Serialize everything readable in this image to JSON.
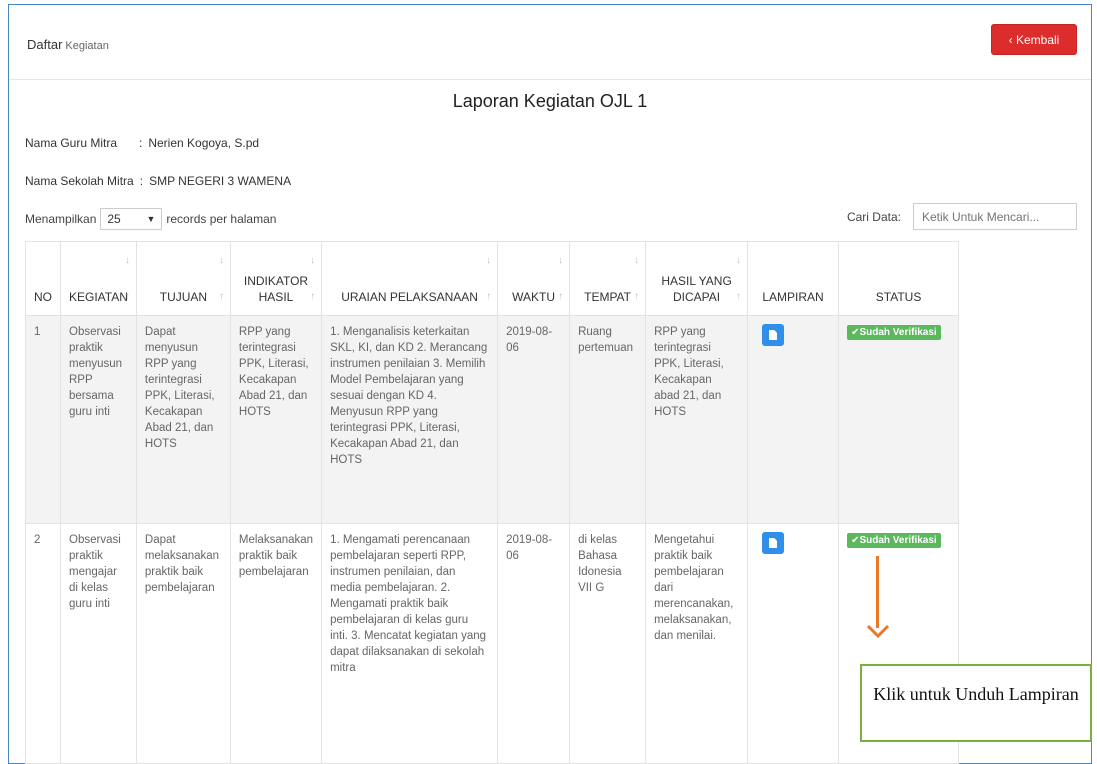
{
  "header": {
    "title": "Daftar",
    "subtitle": "Kegiatan",
    "back_button": "‹ Kembali"
  },
  "report": {
    "title": "Laporan Kegiatan OJL 1",
    "guru_label": "Nama Guru Mitra",
    "guru_sep": ":",
    "guru_value": "Nerien Kogoya, S.pd",
    "sekolah_label": "Nama Sekolah Mitra",
    "sekolah_sep": ":",
    "sekolah_value": "SMP NEGERI 3 WAMENA"
  },
  "controls": {
    "show_label": "Menampilkan",
    "page_size": "25",
    "records_label": "records per halaman",
    "search_label": "Cari Data:",
    "search_placeholder": "Ketik Untuk Mencari..."
  },
  "table": {
    "headers": {
      "no": "NO",
      "kegiatan": "KEGIATAN",
      "tujuan": "TUJUAN",
      "indikator": "INDIKATOR HASIL",
      "uraian": "URAIAN PELAKSANAAN",
      "waktu": "WAKTU",
      "tempat": "TEMPAT",
      "hasil": "HASIL YANG DICAPAI",
      "lampiran": "LAMPIRAN",
      "status": "STATUS"
    },
    "rows": [
      {
        "no": "1",
        "kegiatan": "Observasi praktik menyusun RPP bersama guru inti",
        "tujuan": "Dapat menyusun RPP yang terintegrasi PPK, Literasi, Kecakapan Abad 21, dan HOTS",
        "indikator": "RPP yang terintegrasi PPK, Literasi, Kecakapan Abad 21, dan HOTS",
        "uraian": "1. Menganalisis keterkaitan SKL, KI, dan KD 2. Merancang instrumen penilaian 3. Memilih Model Pembelajaran yang sesuai dengan KD 4. Menyusun RPP yang terintegrasi PPK, Literasi, Kecakapan Abad 21, dan HOTS",
        "waktu": "2019-08-06",
        "tempat": "Ruang pertemuan",
        "hasil": "RPP yang terintegrasi PPK, Literasi, Kecakapan abad 21, dan HOTS",
        "lampiran_icon": "document-icon",
        "status": "✔Sudah Verifikasi"
      },
      {
        "no": "2",
        "kegiatan": "Observasi praktik mengajar di kelas guru inti",
        "tujuan": "Dapat melaksanakan praktik baik pembelajaran",
        "indikator": "Melaksanakan praktik baik pembelajaran",
        "uraian": "1. Mengamati perencanaan pembelajaran seperti RPP, instrumen penilaian, dan media pembelajaran. 2. Mengamati praktik baik pembelajaran di kelas guru inti. 3. Mencatat kegiatan yang dapat dilaksanakan di sekolah mitra",
        "waktu": "2019-08-06",
        "tempat": "di kelas Bahasa Idonesia VII G",
        "hasil": "Mengetahui praktik baik pembelajaran dari merencanakan, melaksanakan, dan menilai.",
        "lampiran_icon": "document-icon",
        "status": "✔Sudah Verifikasi"
      }
    ]
  },
  "callout": {
    "text": "Klik untuk  Unduh Lampiran"
  },
  "colors": {
    "back_button": "#dd2c2c",
    "doc_button": "#2f8fea",
    "badge": "#5cb85c",
    "arrow": "#e8792b",
    "callout_border": "#7aae3f"
  }
}
